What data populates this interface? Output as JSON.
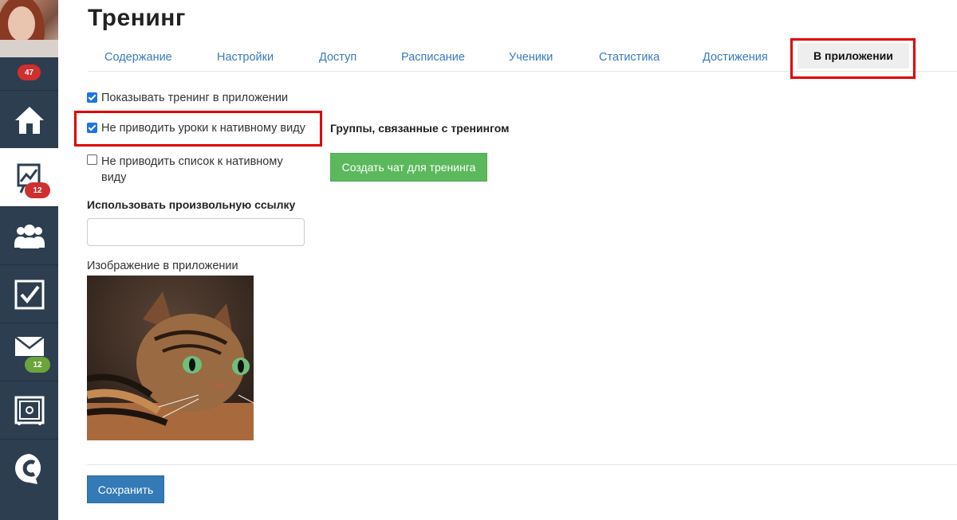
{
  "sidebar": {
    "avatar_badge": "47",
    "items": [
      {
        "icon": "home-icon"
      },
      {
        "icon": "chart-board-icon",
        "badge": "12",
        "badge_color": "#d02f2f"
      },
      {
        "icon": "users-icon"
      },
      {
        "icon": "checkbox-icon"
      },
      {
        "icon": "mail-icon",
        "badge": "12",
        "badge_color": "#6aa43a"
      },
      {
        "icon": "safe-icon"
      },
      {
        "icon": "chat-c-icon"
      }
    ]
  },
  "page": {
    "title": "Тренинг"
  },
  "tabs": [
    {
      "label": "Содержание"
    },
    {
      "label": "Настройки"
    },
    {
      "label": "Доступ"
    },
    {
      "label": "Расписание"
    },
    {
      "label": "Ученики"
    },
    {
      "label": "Статистика"
    },
    {
      "label": "Достижения"
    },
    {
      "label": "В приложении",
      "active": true
    }
  ],
  "form": {
    "show_in_app": {
      "label": "Показывать тренинг в приложении",
      "checked": true
    },
    "no_native_lessons": {
      "label": "Не приводить уроки к нативному виду",
      "checked": true
    },
    "no_native_list": {
      "label_line1": "Не приводить список к нативному",
      "label_line2": "виду",
      "checked": false
    },
    "custom_link": {
      "label": "Использовать произвольную ссылку",
      "value": ""
    },
    "image_label": "Изображение в приложении",
    "groups_title": "Группы, связанные с тренингом",
    "create_chat_button": "Создать чат для тренинга",
    "save_button": "Сохранить"
  },
  "colors": {
    "sidebar": "#2d3e50",
    "tab_link": "#3a7abf",
    "highlight": "#e00000",
    "green_button": "#5cb85c",
    "save_button": "#337ab7"
  }
}
